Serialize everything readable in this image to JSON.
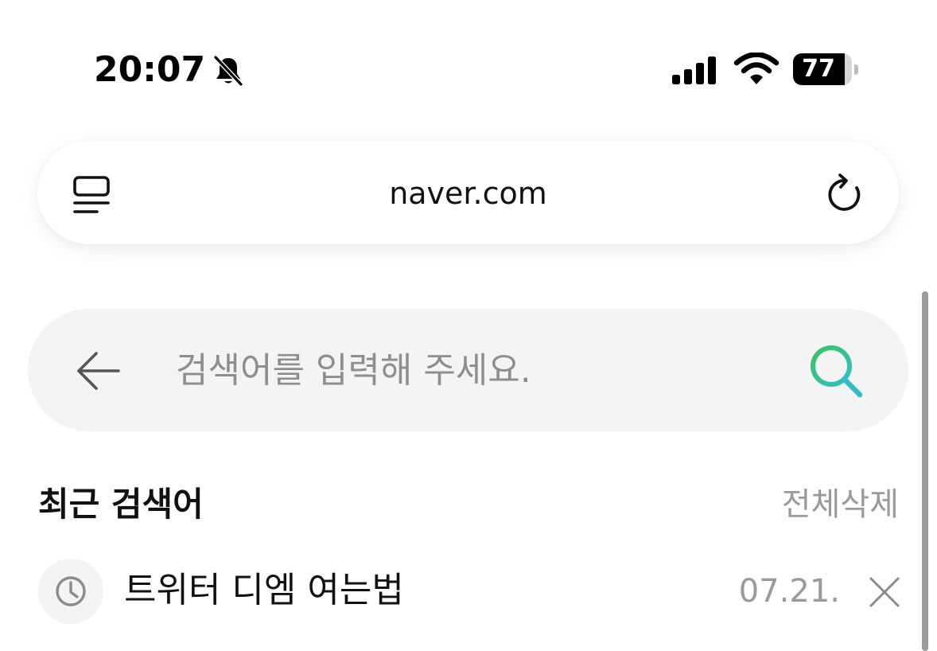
{
  "status_bar": {
    "time": "20:07",
    "battery_level": "77",
    "battery_fraction": 0.77,
    "icons": [
      "bell-slash-icon",
      "cellular-signal-icon",
      "wifi-icon",
      "battery-icon"
    ]
  },
  "address_bar": {
    "url": "naver.com",
    "left_icon": "tabs-list-icon",
    "right_icon": "reload-icon"
  },
  "search": {
    "placeholder": "검색어를 입력해 주세요.",
    "value": "",
    "back_icon": "arrow-left-icon",
    "search_icon": "magnifier-icon",
    "accent_colors": [
      "#39c56b",
      "#2ec0c9"
    ]
  },
  "recent": {
    "title": "최근 검색어",
    "clear_all_label": "전체삭제",
    "items": [
      {
        "text": "트위터 디엠 여는법",
        "date": "07.21.",
        "icon": "clock-icon",
        "delete_icon": "close-icon"
      }
    ]
  }
}
